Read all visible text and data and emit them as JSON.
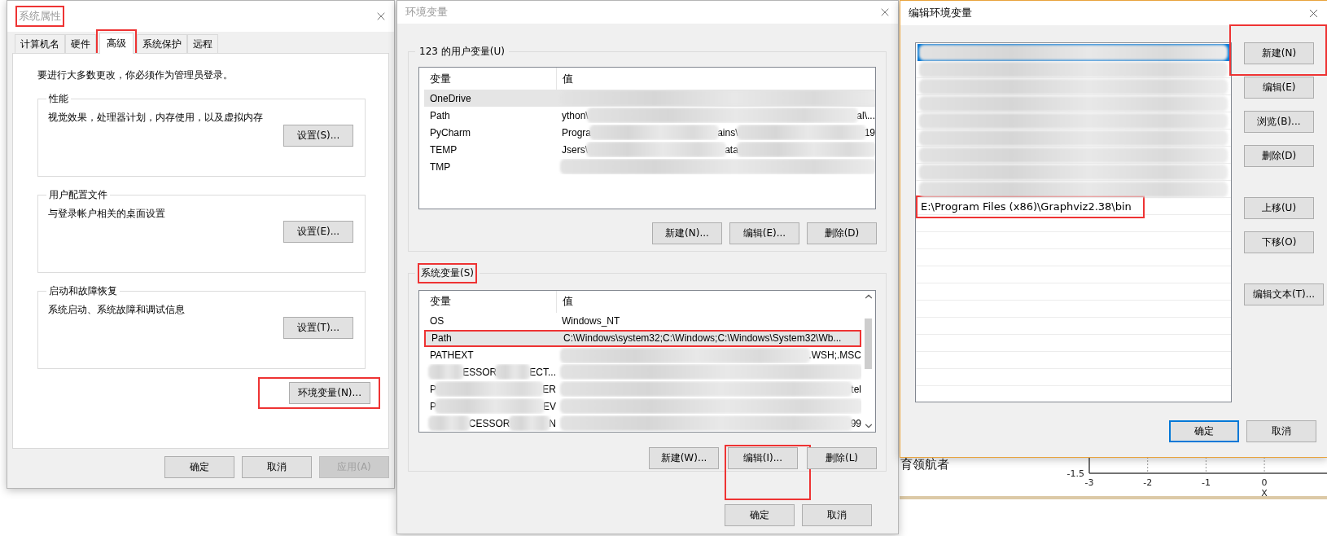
{
  "system_properties": {
    "title": "系统属性",
    "title_annotated": true,
    "tabs": [
      {
        "label": "计算机名",
        "selected": false,
        "annotated": false
      },
      {
        "label": "硬件",
        "selected": false,
        "annotated": false
      },
      {
        "label": "高级",
        "selected": true,
        "annotated": true
      },
      {
        "label": "系统保护",
        "selected": false,
        "annotated": false
      },
      {
        "label": "远程",
        "selected": false,
        "annotated": false
      }
    ],
    "notice": "要进行大多数更改，你必须作为管理员登录。",
    "groups": [
      {
        "title": "性能",
        "description": "视觉效果，处理器计划，内存使用，以及虚拟内存",
        "button": {
          "label": "设置(S)...",
          "annotated": false
        }
      },
      {
        "title": "用户配置文件",
        "description": "与登录帐户相关的桌面设置",
        "button": {
          "label": "设置(E)...",
          "annotated": false
        }
      },
      {
        "title": "启动和故障恢复",
        "description": "系统启动、系统故障和调试信息",
        "button": {
          "label": "设置(T)...",
          "annotated": false
        }
      }
    ],
    "env_button": {
      "label": "环境变量(N)...",
      "annotated": true
    },
    "footer_buttons": [
      {
        "label": "确定",
        "disabled": false
      },
      {
        "label": "取消",
        "disabled": false
      },
      {
        "label": "应用(A)",
        "disabled": true
      }
    ]
  },
  "environment_variables": {
    "title": "环境变量",
    "sections": [
      {
        "title": "123 的用户变量(U)",
        "title_annotated": false,
        "columns": [
          "变量",
          "值"
        ],
        "scrollbar": false,
        "rows": [
          {
            "selected": true,
            "annotated": false,
            "name": [
              {
                "kind": "text",
                "text": "OneDrive"
              }
            ],
            "value": [
              {
                "kind": "redacted"
              }
            ]
          },
          {
            "selected": false,
            "annotated": false,
            "name": [
              {
                "kind": "text",
                "text": "Path"
              }
            ],
            "value": [
              {
                "kind": "text",
                "text": "ython\\"
              },
              {
                "kind": "redacted"
              },
              {
                "kind": "text",
                "text": "al\\..."
              }
            ]
          },
          {
            "selected": false,
            "annotated": false,
            "name": [
              {
                "kind": "text",
                "text": "PyCharm"
              }
            ],
            "value": [
              {
                "kind": "text",
                "text": "Progra"
              },
              {
                "kind": "redacted"
              },
              {
                "kind": "text",
                "text": "ains\\"
              },
              {
                "kind": "redacted"
              },
              {
                "kind": "text",
                "text": "19"
              }
            ]
          },
          {
            "selected": false,
            "annotated": false,
            "name": [
              {
                "kind": "text",
                "text": "TEMP"
              }
            ],
            "value": [
              {
                "kind": "text",
                "text": "Jsers\\"
              },
              {
                "kind": "redacted"
              },
              {
                "kind": "text",
                "text": "ata"
              },
              {
                "kind": "redacted"
              }
            ]
          },
          {
            "selected": false,
            "annotated": false,
            "name": [
              {
                "kind": "text",
                "text": "TMP"
              }
            ],
            "value": [
              {
                "kind": "redacted"
              }
            ]
          }
        ],
        "buttons": [
          {
            "label": "新建(N)...",
            "annotated": false
          },
          {
            "label": "编辑(E)...",
            "annotated": false
          },
          {
            "label": "删除(D)",
            "annotated": false
          }
        ]
      },
      {
        "title": "系统变量(S)",
        "title_annotated": true,
        "columns": [
          "变量",
          "值"
        ],
        "scrollbar": true,
        "rows": [
          {
            "selected": false,
            "annotated": false,
            "name": [
              {
                "kind": "text",
                "text": "OS"
              }
            ],
            "value": [
              {
                "kind": "text",
                "text": "Windows_NT"
              }
            ]
          },
          {
            "selected": true,
            "annotated": true,
            "name": [
              {
                "kind": "text",
                "text": "Path"
              }
            ],
            "value": [
              {
                "kind": "text",
                "text": "C:\\Windows\\system32;C:\\Windows;C:\\Windows\\System32\\Wb..."
              }
            ]
          },
          {
            "selected": false,
            "annotated": false,
            "name": [
              {
                "kind": "text",
                "text": "PATHEXT"
              }
            ],
            "value": [
              {
                "kind": "redacted"
              },
              {
                "kind": "text",
                "text": ".WSH;.MSC"
              }
            ]
          },
          {
            "selected": false,
            "annotated": false,
            "name": [
              {
                "kind": "redacted"
              },
              {
                "kind": "text",
                "text": "ESSOR"
              },
              {
                "kind": "redacted"
              },
              {
                "kind": "text",
                "text": "ECT..."
              }
            ],
            "value": [
              {
                "kind": "redacted"
              }
            ]
          },
          {
            "selected": false,
            "annotated": false,
            "name": [
              {
                "kind": "text",
                "text": "P"
              },
              {
                "kind": "redacted"
              },
              {
                "kind": "text",
                "text": "ER"
              }
            ],
            "value": [
              {
                "kind": "redacted"
              },
              {
                "kind": "text",
                "text": "tel"
              }
            ]
          },
          {
            "selected": false,
            "annotated": false,
            "name": [
              {
                "kind": "text",
                "text": "P"
              },
              {
                "kind": "redacted"
              },
              {
                "kind": "text",
                "text": "EV"
              }
            ],
            "value": [
              {
                "kind": "redacted"
              }
            ]
          },
          {
            "selected": false,
            "annotated": false,
            "name": [
              {
                "kind": "redacted"
              },
              {
                "kind": "text",
                "text": "CESSOR"
              },
              {
                "kind": "redacted"
              },
              {
                "kind": "text",
                "text": "N"
              }
            ],
            "value": [
              {
                "kind": "redacted"
              },
              {
                "kind": "text",
                "text": "99"
              }
            ]
          }
        ],
        "buttons": [
          {
            "label": "新建(W)...",
            "annotated": false
          },
          {
            "label": "编辑(I)...",
            "annotated": true
          },
          {
            "label": "删除(L)",
            "annotated": false
          }
        ]
      }
    ],
    "footer_buttons": [
      {
        "label": "确定"
      },
      {
        "label": "取消"
      }
    ]
  },
  "edit_environment_variable": {
    "title": "编辑环境变量",
    "entries": [
      {
        "selected": true,
        "annotated": false,
        "parts": [
          {
            "kind": "redacted"
          }
        ]
      },
      {
        "selected": false,
        "annotated": false,
        "parts": [
          {
            "kind": "redacted"
          }
        ]
      },
      {
        "selected": false,
        "annotated": false,
        "parts": [
          {
            "kind": "redacted"
          }
        ]
      },
      {
        "selected": false,
        "annotated": false,
        "parts": [
          {
            "kind": "redacted"
          }
        ]
      },
      {
        "selected": false,
        "annotated": false,
        "parts": [
          {
            "kind": "redacted"
          }
        ]
      },
      {
        "selected": false,
        "annotated": false,
        "parts": [
          {
            "kind": "redacted"
          }
        ]
      },
      {
        "selected": false,
        "annotated": false,
        "parts": [
          {
            "kind": "redacted"
          }
        ]
      },
      {
        "selected": false,
        "annotated": false,
        "parts": [
          {
            "kind": "redacted"
          }
        ]
      },
      {
        "selected": false,
        "annotated": false,
        "parts": [
          {
            "kind": "redacted"
          }
        ]
      },
      {
        "selected": false,
        "annotated": true,
        "parts": [
          {
            "kind": "text",
            "text": "E:\\Program Files (x86)\\Graphviz2.38\\bin"
          }
        ]
      }
    ],
    "button_groups": [
      [
        {
          "label": "新建(N)",
          "annotated": true
        },
        {
          "label": "编辑(E)",
          "annotated": false
        },
        {
          "label": "浏览(B)...",
          "annotated": false
        },
        {
          "label": "删除(D)",
          "annotated": false
        }
      ],
      [
        {
          "label": "上移(U)",
          "annotated": false
        },
        {
          "label": "下移(O)",
          "annotated": false
        }
      ],
      [
        {
          "label": "编辑文本(T)...",
          "annotated": false
        }
      ]
    ],
    "footer_buttons": [
      {
        "label": "确定",
        "focused": true
      },
      {
        "label": "取消",
        "focused": false
      }
    ]
  },
  "background": {
    "caption": "育领航者",
    "axis": {
      "y_tick": "-1.5",
      "x_ticks": [
        "-3",
        "-2",
        "-1",
        "0"
      ],
      "x_label": "X"
    }
  }
}
